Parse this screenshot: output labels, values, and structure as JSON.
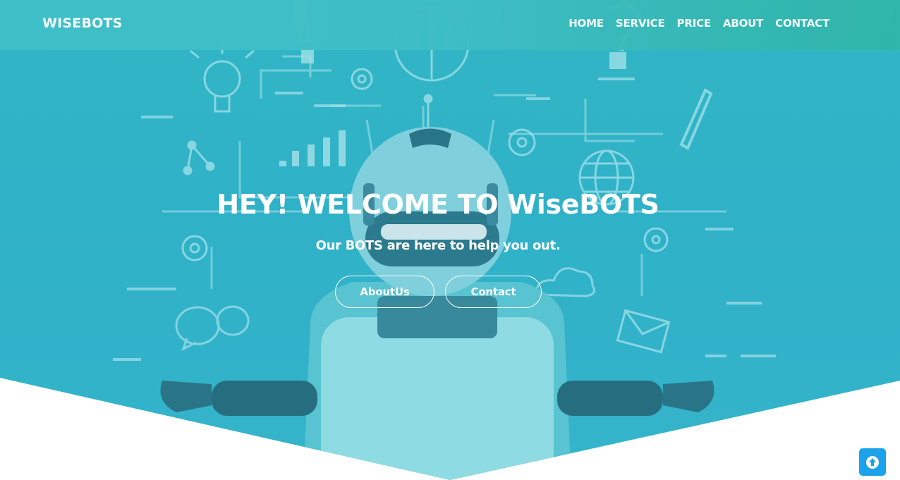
{
  "brand": {
    "name": "WISEBOTS"
  },
  "nav": {
    "items": [
      {
        "label": "HOME"
      },
      {
        "label": "SERVICE"
      },
      {
        "label": "PRICE"
      },
      {
        "label": "ABOUT"
      },
      {
        "label": "CONTACT"
      }
    ]
  },
  "hero": {
    "title": "HEY! WELCOME TO WiseBOTS",
    "subtitle": "Our BOTS are here to help you out.",
    "buttons": [
      {
        "label": "AboutUs"
      },
      {
        "label": "Contact"
      }
    ]
  },
  "icons": {
    "back_to_top": "arrow-up-icon"
  },
  "colors": {
    "navbar": "#3dbdc3",
    "hero_background": "#32b4c8",
    "back_to_top": "#1aa3ea",
    "text": "#ffffff"
  }
}
